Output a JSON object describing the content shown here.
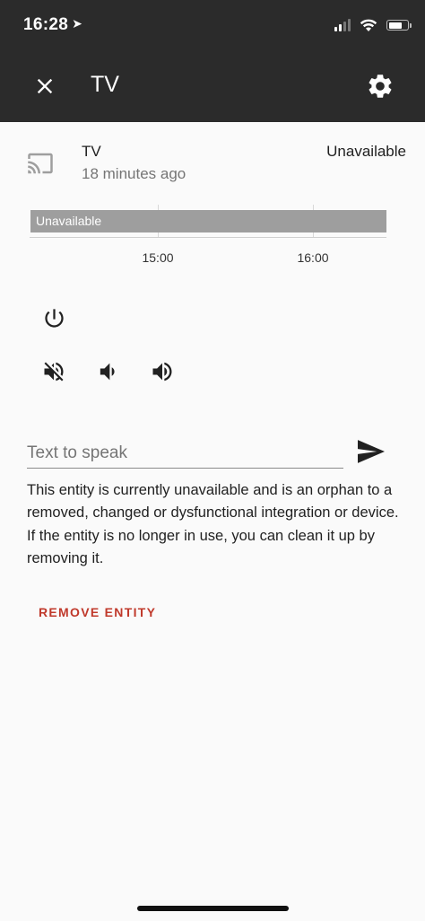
{
  "status_bar": {
    "time": "16:28"
  },
  "dialog": {
    "title": "TV"
  },
  "entity": {
    "name": "TV",
    "last_changed": "18 minutes ago",
    "state": "Unavailable"
  },
  "timeline": {
    "bar_label": "Unavailable",
    "ticks": [
      "15:00",
      "16:00"
    ]
  },
  "tts": {
    "placeholder": "Text to speak"
  },
  "orphan_notice": {
    "line1": "This entity is currently unavailable and is an orphan to a removed, changed or dysfunctional integration or device.",
    "line2": "If the entity is no longer in use, you can clean it up by removing it."
  },
  "actions": {
    "remove_label": "REMOVE ENTITY"
  },
  "colors": {
    "header_bg": "#2b2b2b",
    "timeline_bar": "#9e9e9e",
    "remove_accent": "#c0392b",
    "background": "#fafafa"
  },
  "icons": {
    "close": "close-icon",
    "settings": "gear-icon",
    "entity": "cast-icon",
    "power": "power-icon",
    "mute": "volume-off-icon",
    "vol_down": "volume-down-icon",
    "vol_up": "volume-up-icon",
    "send": "send-icon"
  }
}
